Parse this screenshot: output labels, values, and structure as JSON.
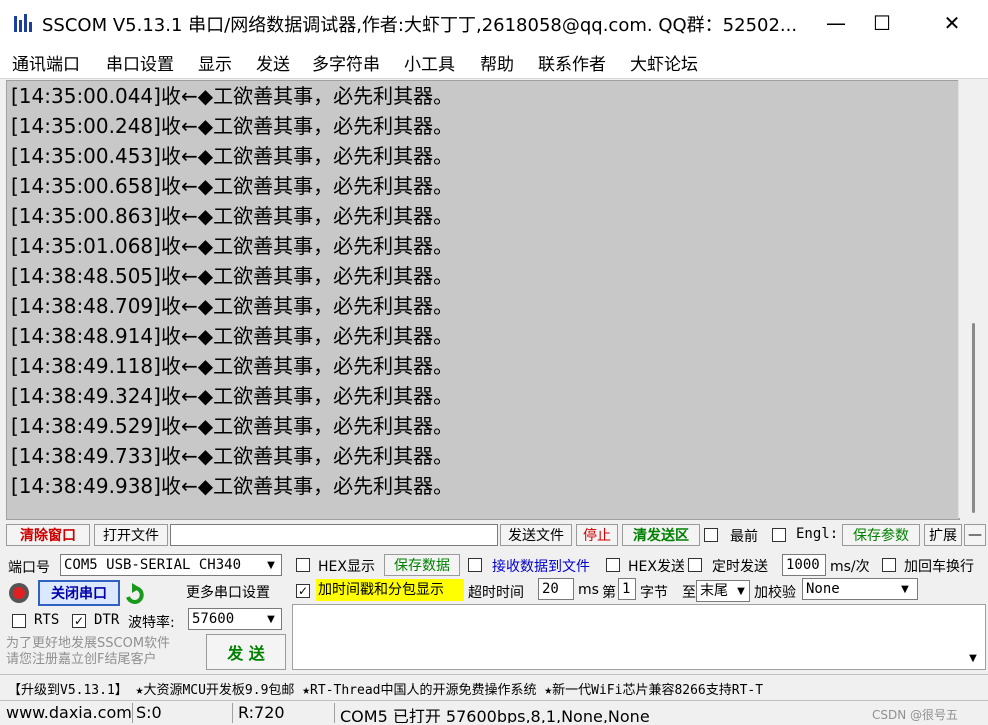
{
  "title": "SSCOM V5.13.1 串口/网络数据调试器,作者:大虾丁丁,2618058@qq.com. QQ群：52502...",
  "window_controls": {
    "minimize": "—",
    "maximize": "☐",
    "close": "✕"
  },
  "menu": [
    "通讯端口",
    "串口设置",
    "显示",
    "发送",
    "多字符串",
    "小工具",
    "帮助",
    "联系作者",
    "大虾论坛"
  ],
  "log_lines": [
    "[14:35:00.044]收←◆工欲善其事，必先利其器。",
    "[14:35:00.248]收←◆工欲善其事，必先利其器。",
    "[14:35:00.453]收←◆工欲善其事，必先利其器。",
    "[14:35:00.658]收←◆工欲善其事，必先利其器。",
    "[14:35:00.863]收←◆工欲善其事，必先利其器。",
    "[14:35:01.068]收←◆工欲善其事，必先利其器。",
    "[14:38:48.505]收←◆工欲善其事，必先利其器。",
    "[14:38:48.709]收←◆工欲善其事，必先利其器。",
    "[14:38:48.914]收←◆工欲善其事，必先利其器。",
    "[14:38:49.118]收←◆工欲善其事，必先利其器。",
    "[14:38:49.324]收←◆工欲善其事，必先利其器。",
    "[14:38:49.529]收←◆工欲善其事，必先利其器。",
    "[14:38:49.733]收←◆工欲善其事，必先利其器。",
    "[14:38:49.938]收←◆工欲善其事，必先利其器。"
  ],
  "toolbar": {
    "clear_window": "清除窗口",
    "open_file": "打开文件",
    "file_path": "",
    "send_file": "发送文件",
    "stop": "停止",
    "clear_send": "清发送区",
    "latest": "最前",
    "english": "Engl:",
    "save_params": "保存参数",
    "expand": "扩展",
    "collapse": "—"
  },
  "port": {
    "port_label": "端口号",
    "port_value": "COM5 USB-SERIAL CH340",
    "close_port": "关闭串口",
    "more_settings": "更多串口设置",
    "rts": "RTS",
    "dtr": "DTR",
    "baud_label": "波特率:",
    "baud_value": "57600",
    "promo": "为了更好地发展SSCOM软件\n请您注册嘉立创F结尾客户",
    "send": "发 送"
  },
  "options": {
    "hex_display": "HEX显示",
    "save_data": "保存数据",
    "recv_to_file": "接收数据到文件",
    "hex_send": "HEX发送",
    "timed_send": "定时发送",
    "interval": "1000",
    "interval_unit": "ms/次",
    "add_crlf": "加回车换行",
    "timestamp": "加时间戳和分包显示",
    "timeout_label": "超时时间",
    "timeout_value": "20",
    "timeout_unit": "ms",
    "byte_prefix": "第",
    "byte_index": "1",
    "byte_unit": "字节",
    "to_label": "至",
    "to_value": "末尾",
    "checksum_label": "加校验",
    "checksum_value": "None"
  },
  "ticker": "【升级到V5.13.1】 ★大资源MCU开发板9.9包邮  ★RT-Thread中国人的开源免费操作系统  ★新一代WiFi芯片兼容8266支持RT-T",
  "status": {
    "url": "www.daxia.com",
    "sent": "S:0",
    "received": "R:720",
    "port_status": "COM5 已打开  57600bps,8,1,None,None"
  },
  "watermark": "CSDN @很号五",
  "colors": {
    "log_bg": "#c8c8c8",
    "highlight": "#ffff00",
    "accent_red": "#cc0000",
    "accent_green": "#008000",
    "accent_blue": "#0000cc"
  }
}
